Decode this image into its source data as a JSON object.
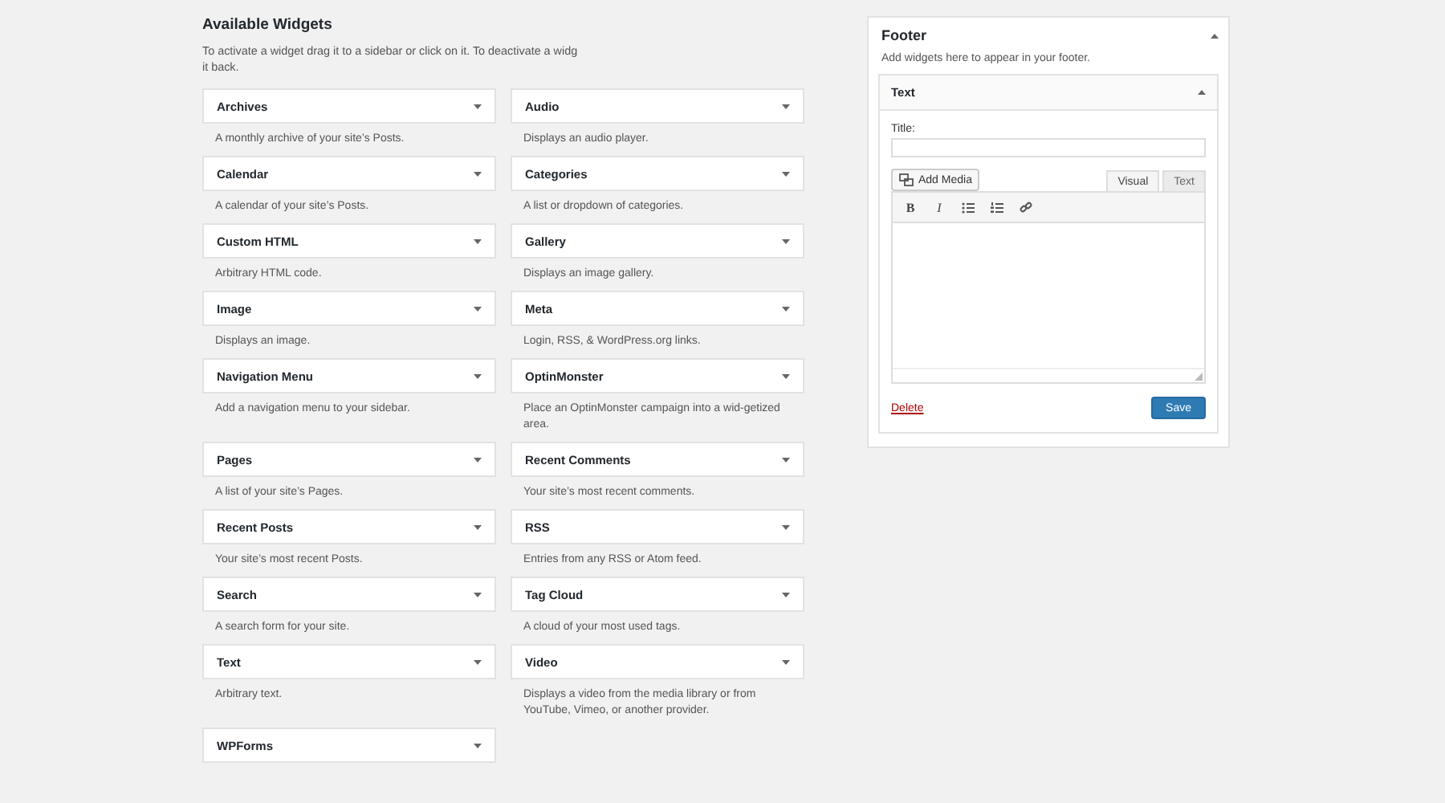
{
  "available": {
    "title": "Available Widgets",
    "instructions": "To activate a widget drag it to a sidebar or click on it. To deactivate a widg",
    "instructions_2": "it back.",
    "widgets": [
      {
        "title": "Archives",
        "description": "A monthly archive of your site’s Posts."
      },
      {
        "title": "Audio",
        "description": "Displays an audio player."
      },
      {
        "title": "Calendar",
        "description": "A calendar of your site’s Posts."
      },
      {
        "title": "Categories",
        "description": "A list or dropdown of categories."
      },
      {
        "title": "Custom HTML",
        "description": "Arbitrary HTML code."
      },
      {
        "title": "Gallery",
        "description": "Displays an image gallery."
      },
      {
        "title": "Image",
        "description": "Displays an image."
      },
      {
        "title": "Meta",
        "description": "Login, RSS, & WordPress.org links."
      },
      {
        "title": "Navigation Menu",
        "description": "Add a navigation menu to your sidebar."
      },
      {
        "title": "OptinMonster",
        "description": "Place an OptinMonster campaign into a wid-getized area."
      },
      {
        "title": "Pages",
        "description": "A list of your site’s Pages."
      },
      {
        "title": "Recent Comments",
        "description": "Your site’s most recent comments."
      },
      {
        "title": "Recent Posts",
        "description": "Your site’s most recent Posts."
      },
      {
        "title": "RSS",
        "description": "Entries from any RSS or Atom feed."
      },
      {
        "title": "Search",
        "description": "A search form for your site."
      },
      {
        "title": "Tag Cloud",
        "description": "A cloud of your most used tags."
      },
      {
        "title": "Text",
        "description": "Arbitrary text."
      },
      {
        "title": "Video",
        "description": "Displays a video from the media library or from YouTube, Vimeo, or another provider."
      },
      {
        "title": "WPForms"
      }
    ]
  },
  "footer_area": {
    "title": "Footer",
    "expanded": true,
    "description": "Add widgets here to appear in your footer.",
    "widget": {
      "title": "Text",
      "expanded": true,
      "title_label": "Title:",
      "add_media": "Add Media",
      "tabs": [
        {
          "label": "Visual",
          "selected": true
        },
        {
          "label": "Text",
          "selected": false
        }
      ],
      "toolbar": [
        {
          "kind": "bold",
          "label": "B"
        },
        {
          "kind": "italic",
          "label": "I"
        },
        {
          "kind": "bullets"
        },
        {
          "kind": "numbers"
        },
        {
          "kind": "link"
        }
      ],
      "delete": "Delete",
      "save": "Save"
    }
  }
}
